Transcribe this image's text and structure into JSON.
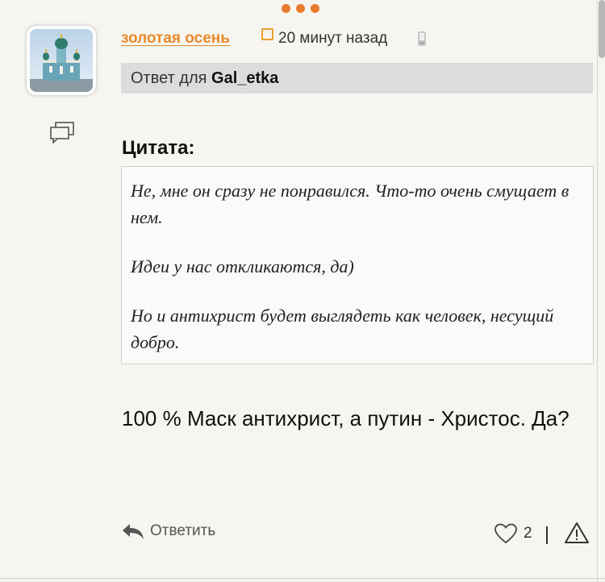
{
  "post": {
    "username": "золотая осень",
    "time": "20 минут назад",
    "reply_prefix": "Ответ для",
    "reply_to": "Gal_etka",
    "quote_title": "Цитата:",
    "quote_paragraphs": [
      "Не, мне он сразу не понравился. Что-то очень смущает в нем.",
      "Идеи у нас откликаются, да)",
      "Но и антихрист будет выглядеть как человек, несущий добро."
    ],
    "message": "100 % Маск антихрист, а путин - Христос. Да?"
  },
  "actions": {
    "reply_label": "Ответить",
    "like_count": "2"
  },
  "colors": {
    "accent": "#e8892a",
    "reply_bar_bg": "#dcdcdc",
    "page_bg": "#f7f5f0"
  },
  "icons": [
    "loading-dots-icon",
    "chat-bubbles-icon",
    "status-square-icon",
    "mobile-phone-icon",
    "reply-arrow-icon",
    "heart-icon",
    "warning-icon"
  ]
}
